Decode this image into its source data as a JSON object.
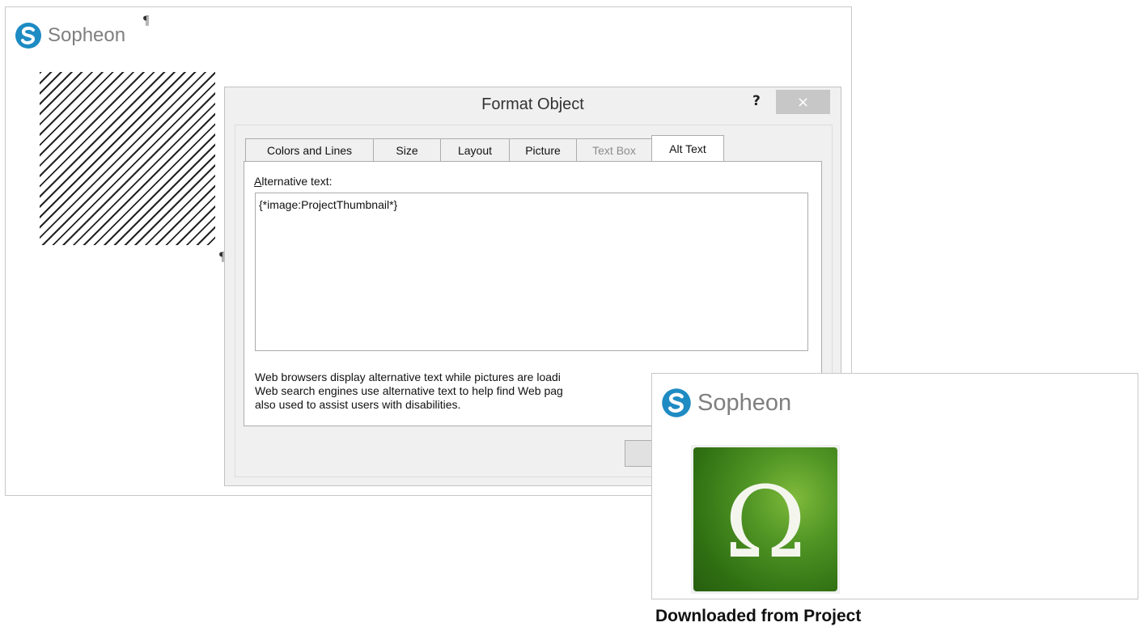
{
  "document": {
    "brand": "Sopheon",
    "pilcrow": "¶"
  },
  "dialog": {
    "title": "Format Object",
    "help_label": "?",
    "close_label": "×",
    "tabs": [
      {
        "label": "Colors and Lines",
        "state": "normal"
      },
      {
        "label": "Size",
        "state": "normal"
      },
      {
        "label": "Layout",
        "state": "normal"
      },
      {
        "label": "Picture",
        "state": "normal"
      },
      {
        "label": "Text Box",
        "state": "disabled"
      },
      {
        "label": "Alt Text",
        "state": "active"
      }
    ],
    "alt_text": {
      "label_accesskey": "A",
      "label_rest": "lternative text:",
      "value": "{*image:ProjectThumbnail*}"
    },
    "help_lines": [
      "Web browsers display alternative text while pictures are loadi",
      "Web search engines use alternative text to help find Web pag",
      "also used to assist users with disabilities."
    ]
  },
  "preview": {
    "brand": "Sopheon",
    "thumbnail_symbol": "Ω",
    "caption": "Downloaded from Project"
  },
  "colors": {
    "brand_blue": "#1e8bc3",
    "brand_gray": "#7f7f7f",
    "thumbnail_green": "#4f9424"
  },
  "icons": {
    "brand_logo": "sopheon-swirl-icon",
    "close": "close-icon",
    "help": "help-icon"
  }
}
